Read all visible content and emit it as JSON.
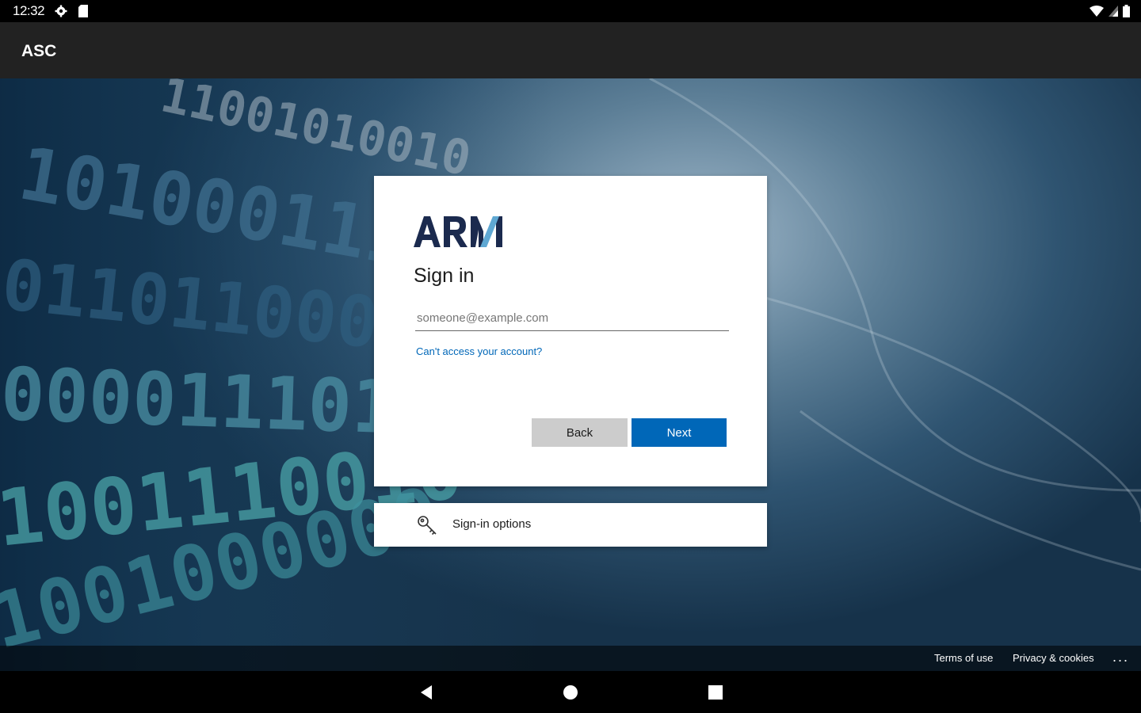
{
  "status_bar": {
    "time": "12:32",
    "icons_left": [
      "settings-icon",
      "sd-card-icon"
    ],
    "icons_right": [
      "wifi-icon",
      "cell-signal-icon",
      "battery-icon"
    ]
  },
  "app_bar": {
    "title": "ASC"
  },
  "signin_card": {
    "logo_text": "ARM",
    "title": "Sign in",
    "email_placeholder": "someone@example.com",
    "email_value": "",
    "cant_access_link": "Can't access your account?",
    "back_button": "Back",
    "next_button": "Next"
  },
  "signin_options": {
    "label": "Sign-in options",
    "icon": "key-icon"
  },
  "footer": {
    "terms": "Terms of use",
    "privacy": "Privacy & cookies",
    "more": "..."
  },
  "nav_bar": {
    "buttons": [
      "back-nav-icon",
      "home-nav-icon",
      "recents-nav-icon"
    ]
  },
  "colors": {
    "accent": "#0067b8",
    "app_bar": "#222222",
    "logo_navy": "#1b2a4e",
    "logo_teal": "#5fa8d3"
  }
}
